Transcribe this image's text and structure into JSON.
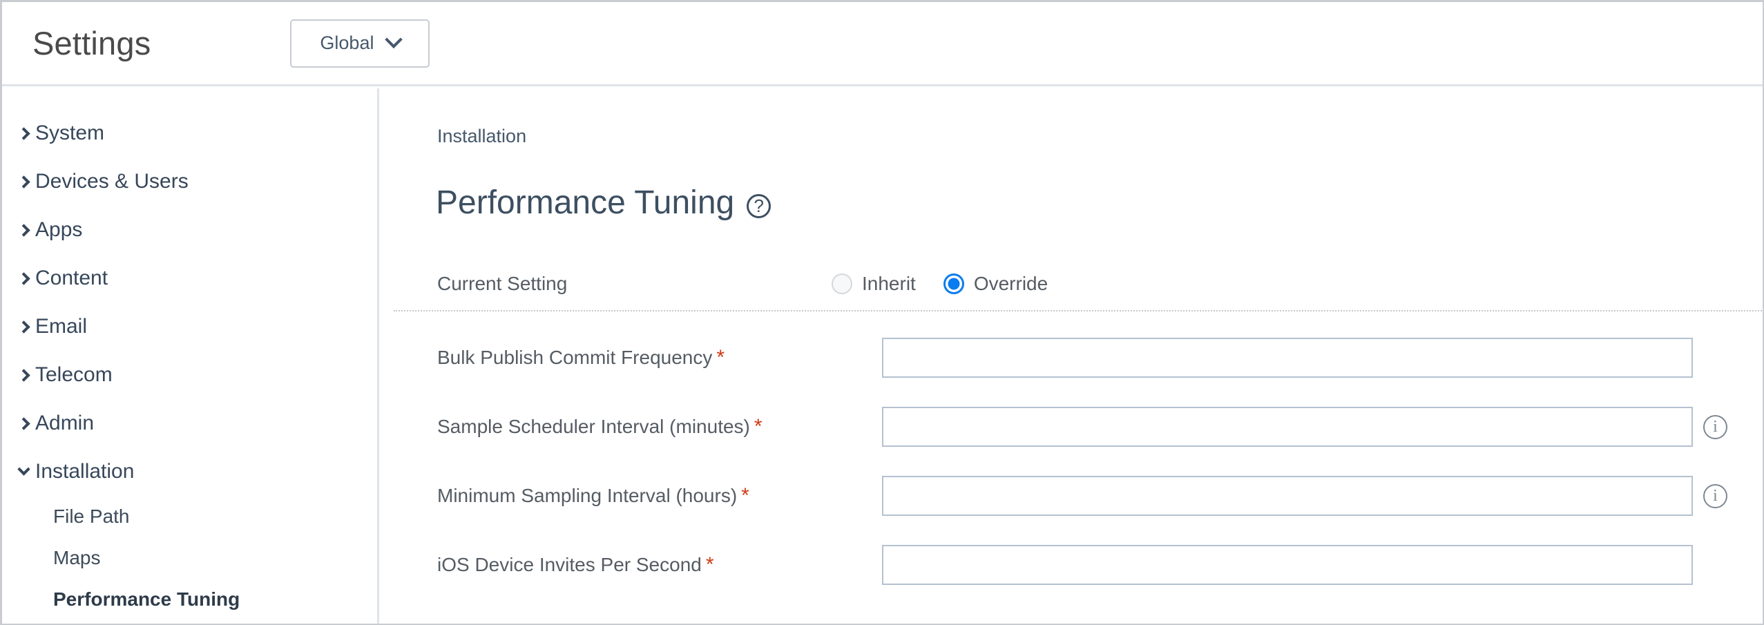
{
  "header": {
    "title": "Settings",
    "scope_dropdown": {
      "value": "Global",
      "chevron_icon": "chevron-down-icon"
    }
  },
  "sidebar": {
    "items": [
      {
        "label": "System",
        "expanded": false,
        "caret_icon": "caret-right-icon"
      },
      {
        "label": "Devices & Users",
        "expanded": false,
        "caret_icon": "caret-right-icon"
      },
      {
        "label": "Apps",
        "expanded": false,
        "caret_icon": "caret-right-icon"
      },
      {
        "label": "Content",
        "expanded": false,
        "caret_icon": "caret-right-icon"
      },
      {
        "label": "Email",
        "expanded": false,
        "caret_icon": "caret-right-icon"
      },
      {
        "label": "Telecom",
        "expanded": false,
        "caret_icon": "caret-right-icon"
      },
      {
        "label": "Admin",
        "expanded": false,
        "caret_icon": "caret-right-icon"
      },
      {
        "label": "Installation",
        "expanded": true,
        "caret_icon": "caret-down-icon"
      }
    ],
    "subitems": [
      {
        "label": "File Path",
        "selected": false
      },
      {
        "label": "Maps",
        "selected": false
      },
      {
        "label": "Performance Tuning",
        "selected": true
      }
    ]
  },
  "main": {
    "breadcrumb": "Installation",
    "page_title": "Performance Tuning",
    "help_icon": "help-circle-icon",
    "help_glyph": "?",
    "current_setting": {
      "label": "Current Setting",
      "options": [
        {
          "label": "Inherit",
          "selected": false
        },
        {
          "label": "Override",
          "selected": true
        }
      ]
    },
    "fields": [
      {
        "label": "Bulk Publish Commit Frequency",
        "required": true,
        "required_marker": "*",
        "value": "",
        "placeholder": "",
        "has_info_icon": false,
        "info_glyph": "i"
      },
      {
        "label": "Sample Scheduler Interval (minutes)",
        "required": true,
        "required_marker": "*",
        "value": "",
        "placeholder": "",
        "has_info_icon": true,
        "info_glyph": "i"
      },
      {
        "label": "Minimum Sampling Interval (hours)",
        "required": true,
        "required_marker": "*",
        "value": "",
        "placeholder": "",
        "has_info_icon": true,
        "info_glyph": "i"
      },
      {
        "label": "iOS Device Invites Per Second",
        "required": true,
        "required_marker": "*",
        "value": "",
        "placeholder": "",
        "has_info_icon": false,
        "info_glyph": "i"
      }
    ]
  },
  "colors": {
    "accent_blue": "#0a7cf0",
    "required_red": "#cf3c14",
    "text_primary": "#3d4b59",
    "text_nav": "#37475a",
    "border_light": "#dfe3e8",
    "input_border": "#b3c1d0"
  }
}
